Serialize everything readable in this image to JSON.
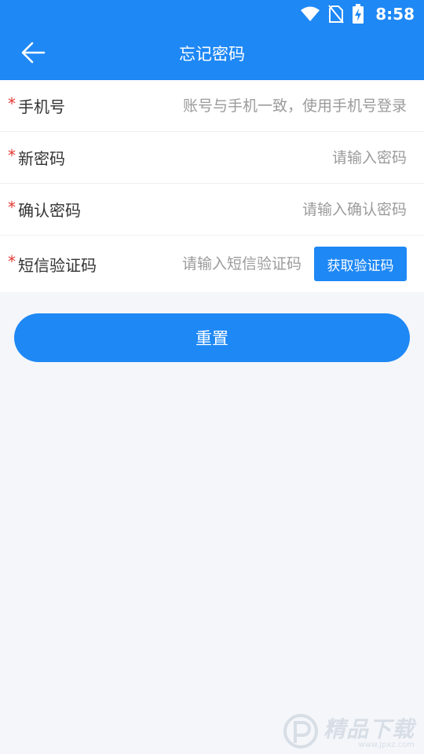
{
  "status_bar": {
    "time": "8:58",
    "icons": [
      "wifi-icon",
      "no-sim-icon",
      "battery-charging-icon"
    ]
  },
  "app_bar": {
    "back_icon": "arrow-left-icon",
    "title": "忘记密码"
  },
  "form": {
    "phone": {
      "required_mark": "*",
      "label": "手机号",
      "placeholder": "账号与手机一致，使用手机号登录",
      "value": ""
    },
    "new_password": {
      "required_mark": "*",
      "label": "新密码",
      "placeholder": "请输入密码",
      "value": ""
    },
    "confirm_password": {
      "required_mark": "*",
      "label": "确认密码",
      "placeholder": "请输入确认密码",
      "value": ""
    },
    "sms_code": {
      "required_mark": "*",
      "label": "短信验证码",
      "placeholder": "请输入短信验证码",
      "value": "",
      "button_label": "获取验证码"
    }
  },
  "actions": {
    "reset_label": "重置"
  },
  "colors": {
    "primary": "#1e88f5",
    "background": "#f4f6fa",
    "required": "#e53935",
    "placeholder": "#9b9b9b"
  },
  "watermark": {
    "title": "精品下载",
    "url": "www.jpxz.com"
  }
}
